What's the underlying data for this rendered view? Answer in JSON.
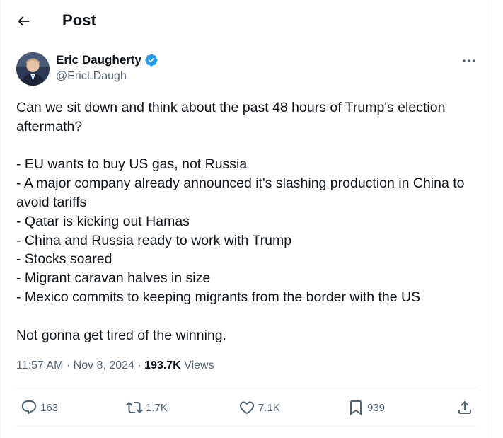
{
  "header": {
    "title": "Post",
    "back_icon": "arrow-left-icon"
  },
  "author": {
    "name": "Eric Daugherty",
    "handle": "@EricLDaugh",
    "verified_icon": "verified-badge-icon",
    "verified_color": "#1d9bf0"
  },
  "post": {
    "paragraphs": [
      "Can we sit down and think about the past 48 hours of Trump's election aftermath?",
      "- EU wants to buy US gas, not Russia\n- A major company already announced it's slashing production in China to avoid tariffs\n- Qatar is kicking out Hamas\n- China and Russia ready to work with Trump\n- Stocks soared\n- Migrant caravan halves in size\n- Mexico commits to keeping migrants from the border with the US",
      "Not gonna get tired of the winning."
    ]
  },
  "meta": {
    "time": "11:57 AM",
    "separator": " · ",
    "date": "Nov 8, 2024",
    "views_count": "193.7K",
    "views_label": " Views"
  },
  "actions": {
    "replies": "163",
    "reposts": "1.7K",
    "likes": "7.1K",
    "bookmarks": "939"
  },
  "colors": {
    "text": "#0f1419",
    "secondary": "#536471",
    "accent": "#1d9bf0",
    "divider": "#eff3f4"
  }
}
